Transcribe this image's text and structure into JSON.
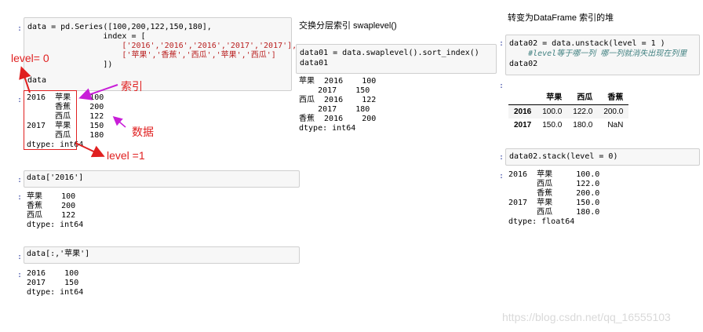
{
  "left": {
    "code_lines": [
      "data = pd.Series([100,200,122,150,180],",
      "                index = [",
      "                    ['2016','2016','2016','2017','2017'],",
      "                    ['苹果','香蕉','西瓜','苹果','西瓜']",
      "                ])",
      "data"
    ],
    "output_lines": [
      "2016  苹果    100",
      "      香蕉    200",
      "      西瓜    122",
      "2017  苹果    150",
      "      西瓜    180",
      "dtype: int64"
    ],
    "cell2_code": "data['2016']",
    "cell2_output": [
      "苹果    100",
      "香蕉    200",
      "西瓜    122",
      "dtype: int64"
    ],
    "cell3_code": "data[:,'苹果']",
    "cell3_output": [
      "2016    100",
      "2017    150",
      "dtype: int64"
    ],
    "annotations": {
      "level0": "level= 0",
      "index": "索引",
      "data": "数据",
      "level1": "level =1"
    }
  },
  "middle": {
    "heading": "交换分层索引 swaplevel()",
    "code_lines": [
      "data01 = data.swaplevel().sort_index()",
      "data01"
    ],
    "output_lines": [
      "苹果  2016    100",
      "    2017    150",
      "西瓜  2016    122",
      "    2017    180",
      "香蕉  2016    200",
      "dtype: int64"
    ]
  },
  "right": {
    "heading": "转变为DataFrame 索引的堆",
    "code_line1": "data02 = data.unstack(level = 1 )",
    "comment_line": "    #level等于哪一列 哪一列就消失出现在列里",
    "code_line3": "data02",
    "table": {
      "columns": [
        "",
        "苹果",
        "西瓜",
        "香蕉"
      ],
      "rows": [
        [
          "2016",
          "100.0",
          "122.0",
          "200.0"
        ],
        [
          "2017",
          "150.0",
          "180.0",
          "NaN"
        ]
      ]
    },
    "stack_code": "data02.stack(level = 0)",
    "stack_output": [
      "2016  苹果     100.0",
      "      西瓜     122.0",
      "      香蕉     200.0",
      "2017  苹果     150.0",
      "      西瓜     180.0",
      "dtype: float64"
    ]
  },
  "watermark": "https://blog.csdn.net/qq_16555103",
  "prompt_symbol": ":",
  "colors": {
    "annotation_red": "#e02020",
    "annotation_magenta": "#c81ed8",
    "cell_bg": "#f7f7f7"
  }
}
